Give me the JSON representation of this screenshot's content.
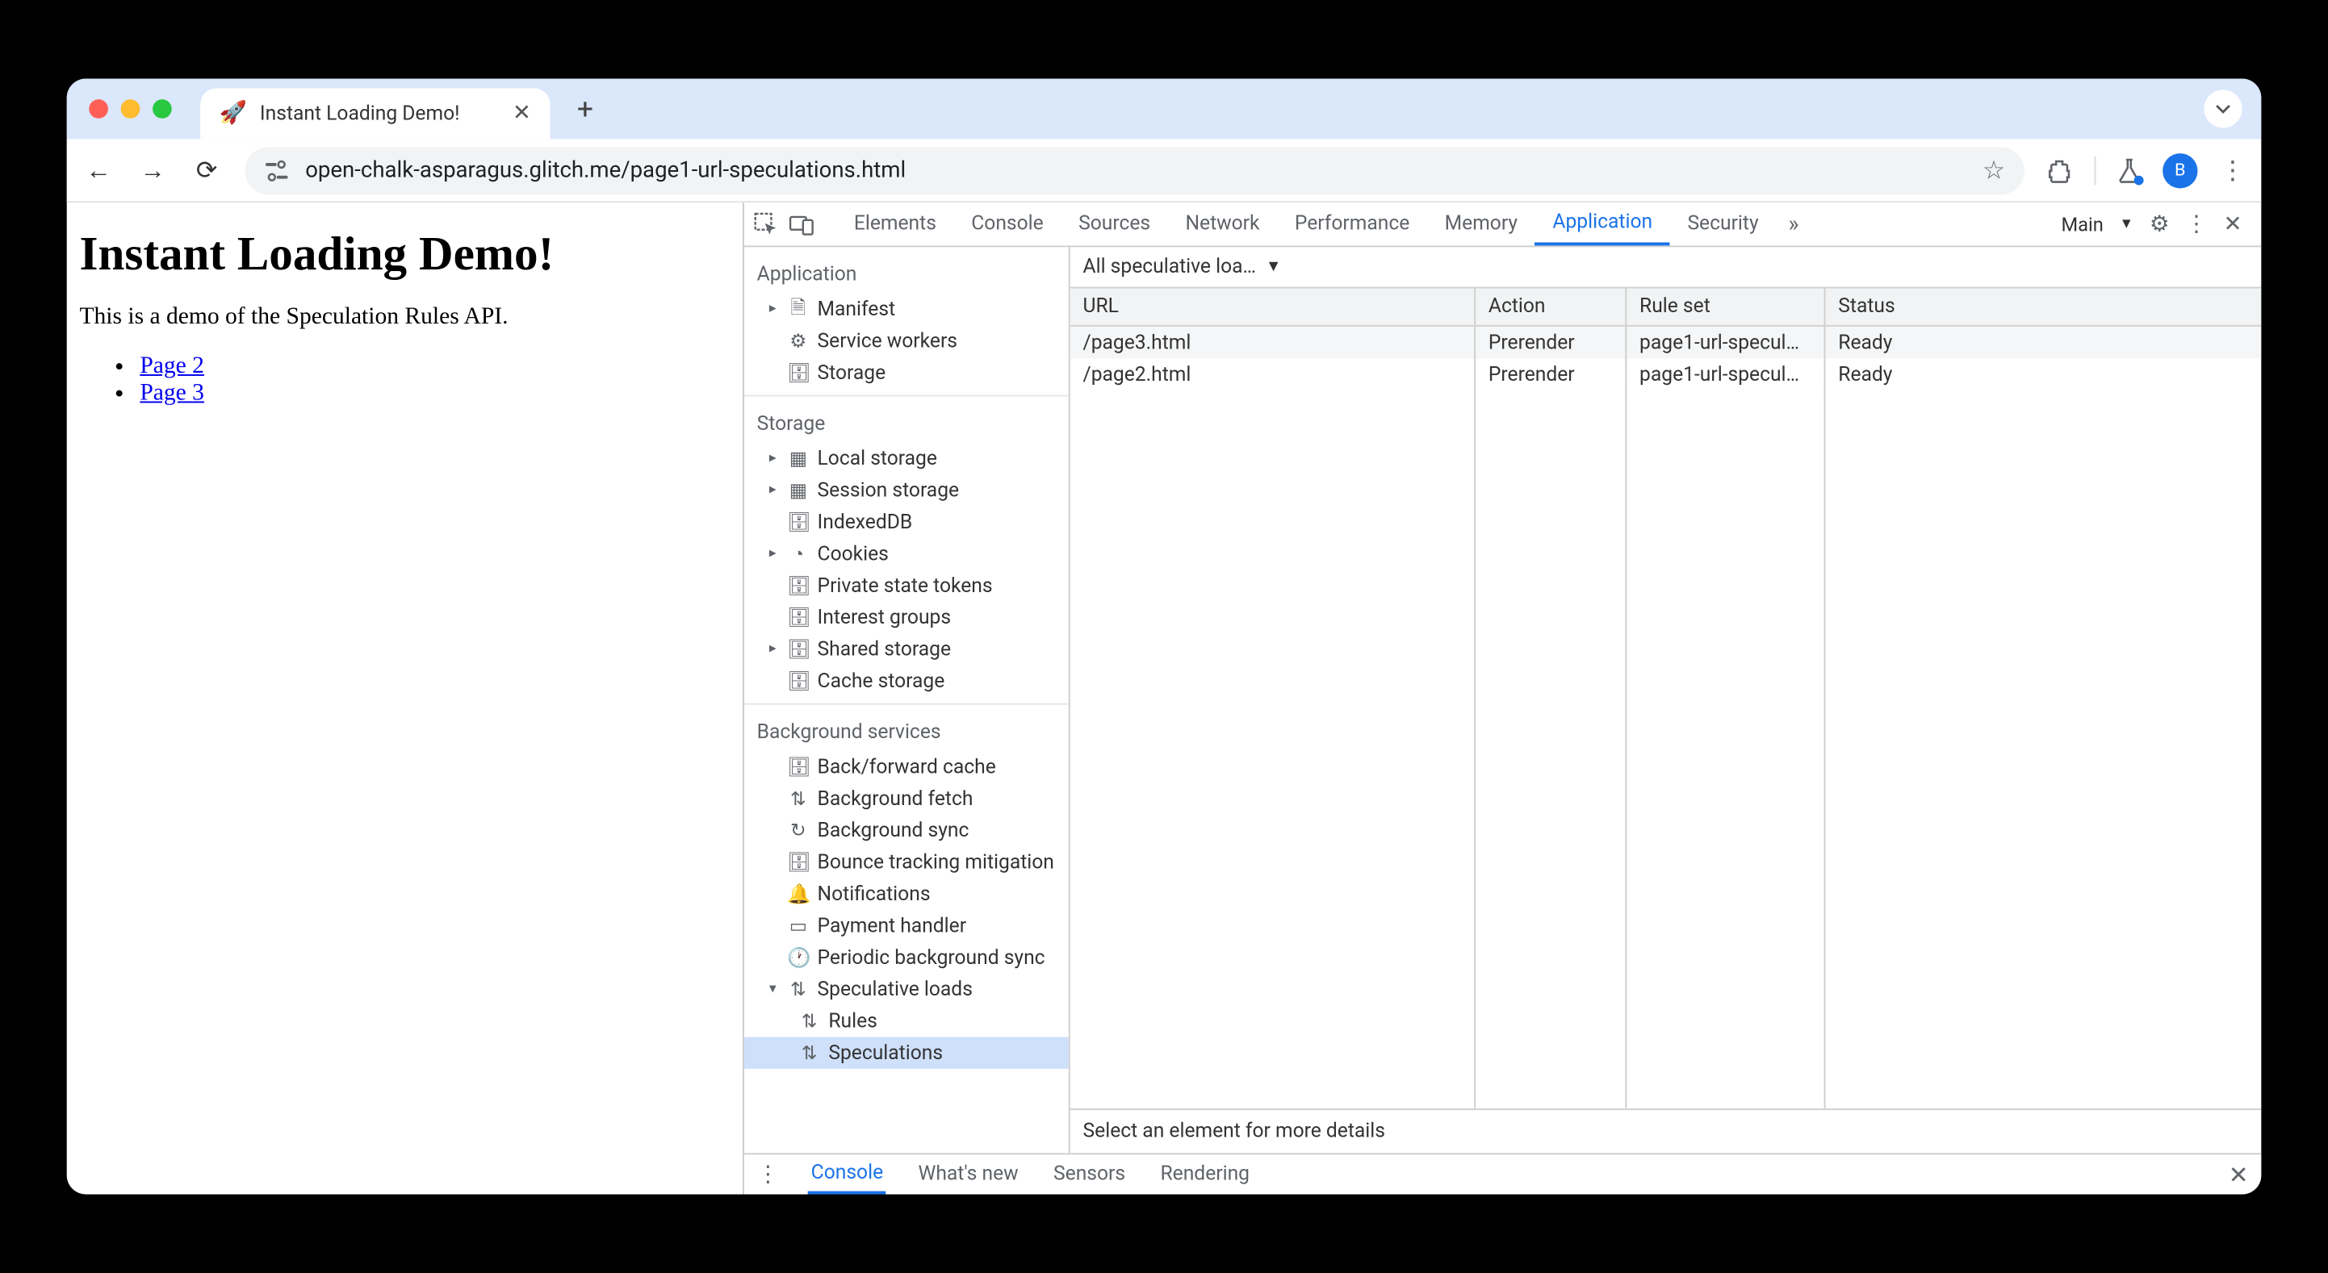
{
  "browser": {
    "tab": {
      "favicon": "🚀",
      "title": "Instant Loading Demo!"
    },
    "url": "open-chalk-asparagus.glitch.me/page1-url-speculations.html",
    "avatar_letter": "B"
  },
  "page": {
    "heading": "Instant Loading Demo!",
    "intro": "This is a demo of the Speculation Rules API.",
    "links": [
      {
        "text": "Page 2"
      },
      {
        "text": "Page 3"
      }
    ]
  },
  "devtools": {
    "tabs": [
      "Elements",
      "Console",
      "Sources",
      "Network",
      "Performance",
      "Memory",
      "Application",
      "Security"
    ],
    "active_tab": "Application",
    "target_label": "Main",
    "sidebar": {
      "sections": [
        {
          "title": "Application",
          "items": [
            {
              "icon": "file",
              "label": "Manifest",
              "expandable": true
            },
            {
              "icon": "gears",
              "label": "Service workers"
            },
            {
              "icon": "db",
              "label": "Storage"
            }
          ]
        },
        {
          "title": "Storage",
          "items": [
            {
              "icon": "grid",
              "label": "Local storage",
              "expandable": true
            },
            {
              "icon": "grid",
              "label": "Session storage",
              "expandable": true
            },
            {
              "icon": "db",
              "label": "IndexedDB"
            },
            {
              "icon": "cookie",
              "label": "Cookies",
              "expandable": true
            },
            {
              "icon": "db",
              "label": "Private state tokens"
            },
            {
              "icon": "db",
              "label": "Interest groups"
            },
            {
              "icon": "db",
              "label": "Shared storage",
              "expandable": true
            },
            {
              "icon": "db",
              "label": "Cache storage"
            }
          ]
        },
        {
          "title": "Background services",
          "items": [
            {
              "icon": "db",
              "label": "Back/forward cache"
            },
            {
              "icon": "arrows",
              "label": "Background fetch"
            },
            {
              "icon": "sync",
              "label": "Background sync"
            },
            {
              "icon": "db",
              "label": "Bounce tracking mitigation"
            },
            {
              "icon": "bell",
              "label": "Notifications"
            },
            {
              "icon": "card",
              "label": "Payment handler"
            },
            {
              "icon": "clock",
              "label": "Periodic background sync"
            },
            {
              "icon": "arrows",
              "label": "Speculative loads",
              "expandable": true,
              "expanded": true,
              "children": [
                {
                  "icon": "arrows",
                  "label": "Rules"
                },
                {
                  "icon": "arrows",
                  "label": "Speculations",
                  "selected": true
                }
              ]
            }
          ]
        }
      ]
    },
    "filter_label": "All speculative loa…",
    "table": {
      "columns": [
        "URL",
        "Action",
        "Rule set",
        "Status"
      ],
      "rows": [
        {
          "url": "/page3.html",
          "action": "Prerender",
          "ruleset": "page1-url-specul…",
          "status": "Ready"
        },
        {
          "url": "/page2.html",
          "action": "Prerender",
          "ruleset": "page1-url-specul…",
          "status": "Ready"
        }
      ]
    },
    "detail_placeholder": "Select an element for more details",
    "drawer_tabs": [
      "Console",
      "What's new",
      "Sensors",
      "Rendering"
    ],
    "drawer_active": "Console"
  }
}
